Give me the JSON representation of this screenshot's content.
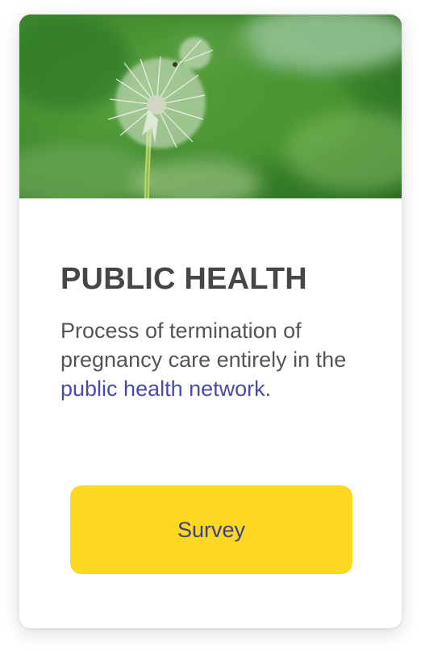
{
  "card": {
    "title": "PUBLIC HEALTH",
    "description_before": "Process of termination of pregnancy care entirely in the ",
    "description_link": "public health network",
    "description_after": ".",
    "button_label": "Survey",
    "image_icon": "dandelion-photo"
  },
  "colors": {
    "title": "#464646",
    "text": "#555555",
    "link": "#4a4aa8",
    "button_bg": "#fcd920",
    "button_text": "#3d3d93"
  }
}
